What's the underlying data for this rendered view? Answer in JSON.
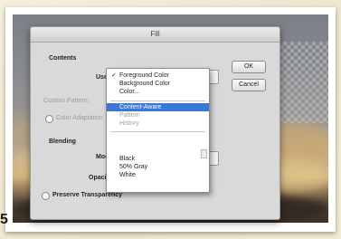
{
  "step_number": "5",
  "dialog": {
    "title": "Fill",
    "contents_section": "Contents",
    "use_label": "Use:",
    "custom_pattern_label": "Custom Pattern:",
    "color_adapt_label": "Color Adaptation",
    "blending_section": "Blending",
    "mode_label": "Mode:",
    "opacity_label": "Opacity:",
    "preserve_transparency_label": "Preserve Transparency",
    "ok_label": "OK",
    "cancel_label": "Cancel"
  },
  "use_menu": {
    "checked_mark": "✓",
    "items": [
      {
        "label": "Foreground Color",
        "state": "checked"
      },
      {
        "label": "Background Color",
        "state": "normal"
      },
      {
        "label": "Color...",
        "state": "normal"
      },
      {
        "label": "Content-Aware",
        "state": "selected"
      },
      {
        "label": "Pattern",
        "state": "disabled"
      },
      {
        "label": "History",
        "state": "disabled"
      },
      {
        "label": "Black",
        "state": "normal"
      },
      {
        "label": "50% Gray",
        "state": "normal"
      },
      {
        "label": "White",
        "state": "normal"
      }
    ]
  },
  "colors": {
    "highlight": "#3a78d8",
    "dialog_bg": "#d9d9d9"
  }
}
